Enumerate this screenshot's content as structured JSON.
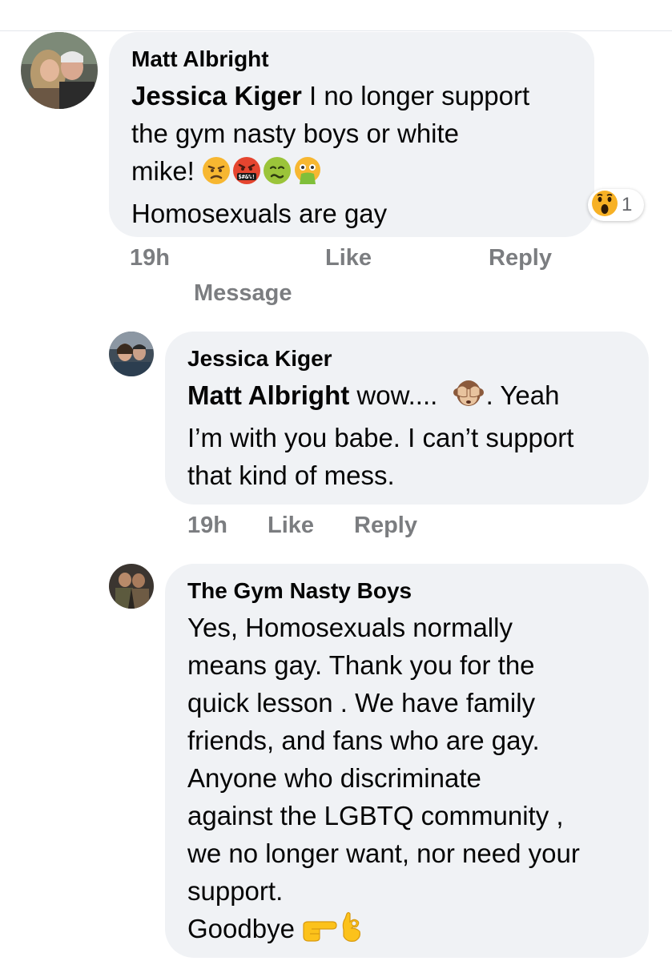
{
  "colors": {
    "bubble": "#f0f2f5",
    "meta_text": "#65676b",
    "text": "#050505"
  },
  "comments": [
    {
      "author": "Matt Albright",
      "mention": "Jessica Kiger",
      "text_line1": " I no longer support",
      "text_line2": "the gym nasty boys or white",
      "text_line3": "mike! ",
      "emojis": [
        "angry-face-icon",
        "cursing-face-icon",
        "nauseated-face-icon",
        "vomiting-face-icon"
      ],
      "text_line4": "Homosexuals are gay",
      "reaction": {
        "icon": "wow-reaction-icon",
        "count": "1"
      },
      "time": "19h",
      "like": "Like",
      "reply": "Reply",
      "message": "Message"
    },
    {
      "author": "Jessica Kiger",
      "mention": "Matt Albright",
      "text_after_mention": " wow....",
      "emoji": "see-no-evil-monkey-icon",
      "text_after_emoji": ". Yeah",
      "text_line2": "I’m with you babe. I can’t support",
      "text_line3": "that kind of mess.",
      "time": "19h",
      "like": "Like",
      "reply": "Reply"
    },
    {
      "author": "The Gym Nasty Boys",
      "lines": [
        "Yes, Homosexuals normally",
        "means gay. Thank you for the",
        "quick lesson . We have family",
        "friends, and fans who are gay.",
        "Anyone who discriminate",
        "against the LGBTQ community ,",
        "we no longer want, nor need your",
        "support."
      ],
      "last_line": "Goodbye ",
      "emojis": [
        "backhand-index-pointing-right-icon",
        "ok-hand-icon"
      ]
    }
  ]
}
